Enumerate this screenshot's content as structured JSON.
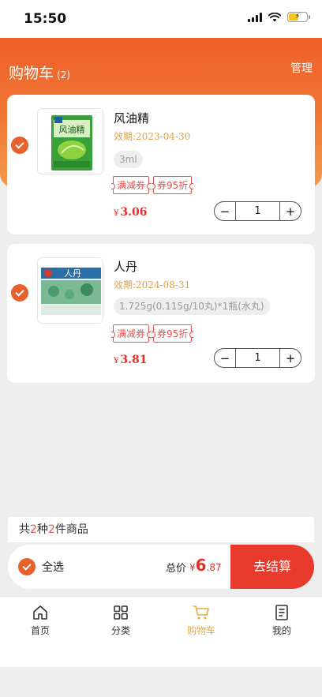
{
  "status_bar": {
    "time": "15:50"
  },
  "header": {
    "title": "购物车",
    "count": "(2)",
    "manage": "管理"
  },
  "cart_items": [
    {
      "name": "风油精",
      "expiry_label": "效期:",
      "expiry_date": "2023-04-30",
      "spec": "3ml",
      "coupons": [
        "满减券",
        "券95折"
      ],
      "currency": "¥",
      "price": "3.06",
      "quantity": "1",
      "package_text": "风油精",
      "package_colors": [
        "#3aa13a",
        "#8cd33f"
      ]
    },
    {
      "name": "人丹",
      "expiry_label": "效期:",
      "expiry_date": "2024-08-31",
      "spec": "1.725g(0.115g/10丸)*1瓶(水丸)",
      "coupons": [
        "满减券",
        "券95折"
      ],
      "currency": "¥",
      "price": "3.81",
      "quantity": "1",
      "package_text": "人丹",
      "package_colors": [
        "#2a6ea8",
        "#7bb894"
      ]
    }
  ],
  "stepper": {
    "minus": "−",
    "plus": "+"
  },
  "summary": {
    "prefix": "共",
    "kinds": "2",
    "middle": "种",
    "pieces": "2",
    "suffix": "件商品"
  },
  "checkout": {
    "select_all": "全选",
    "total_label": "总价",
    "currency": "¥",
    "total_int": "6",
    "total_dec": ".87",
    "button": "去结算"
  },
  "tabs": [
    {
      "label": "首页",
      "icon": "home-icon",
      "active": false
    },
    {
      "label": "分类",
      "icon": "grid-icon",
      "active": false
    },
    {
      "label": "购物车",
      "icon": "cart-icon",
      "active": true
    },
    {
      "label": "我的",
      "icon": "profile-doc-icon",
      "active": false
    }
  ],
  "colors": {
    "accent": "#e8612c",
    "price": "#e5302b",
    "checkout": "#e83a2c",
    "tab_active": "#f0a63e",
    "expiry": "#e3a04b"
  }
}
